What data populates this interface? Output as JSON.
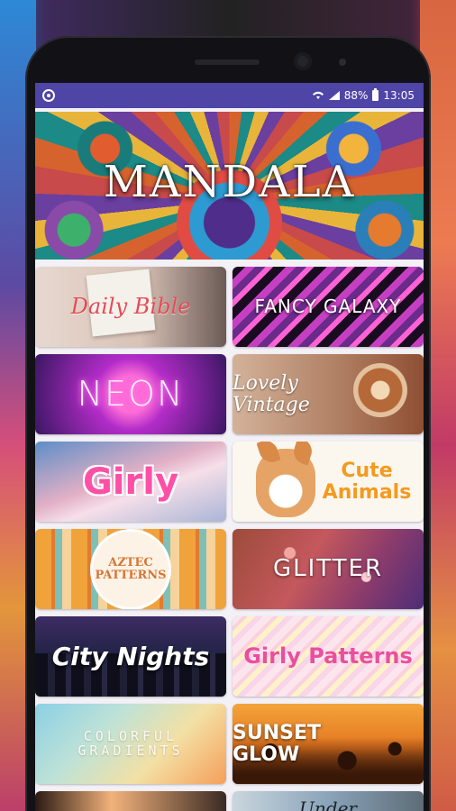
{
  "status_bar": {
    "battery": "88%",
    "time": "13:05"
  },
  "hero": {
    "title": "MANDALA"
  },
  "tiles": [
    {
      "label": "Daily Bible"
    },
    {
      "label": "FANCY GALAXY"
    },
    {
      "label": "NEON"
    },
    {
      "label": "Lovely Vintage"
    },
    {
      "label": "Girly"
    },
    {
      "label": "Cute Animals"
    },
    {
      "label": "AZTEC PATTERNS"
    },
    {
      "label": "GLITTER"
    },
    {
      "label": "City Nights"
    },
    {
      "label": "Girly Patterns"
    },
    {
      "label": "COLORFUL GRADIENTS"
    },
    {
      "label": "SUNSET GLOW"
    },
    {
      "label": ""
    },
    {
      "label": "Under"
    }
  ],
  "colors": {
    "status_bar": "#4f45a6",
    "screen_bg": "#f3f1f6"
  },
  "icons": [
    "app-indicator-icon",
    "wifi-icon",
    "signal-icon",
    "battery-icon"
  ]
}
